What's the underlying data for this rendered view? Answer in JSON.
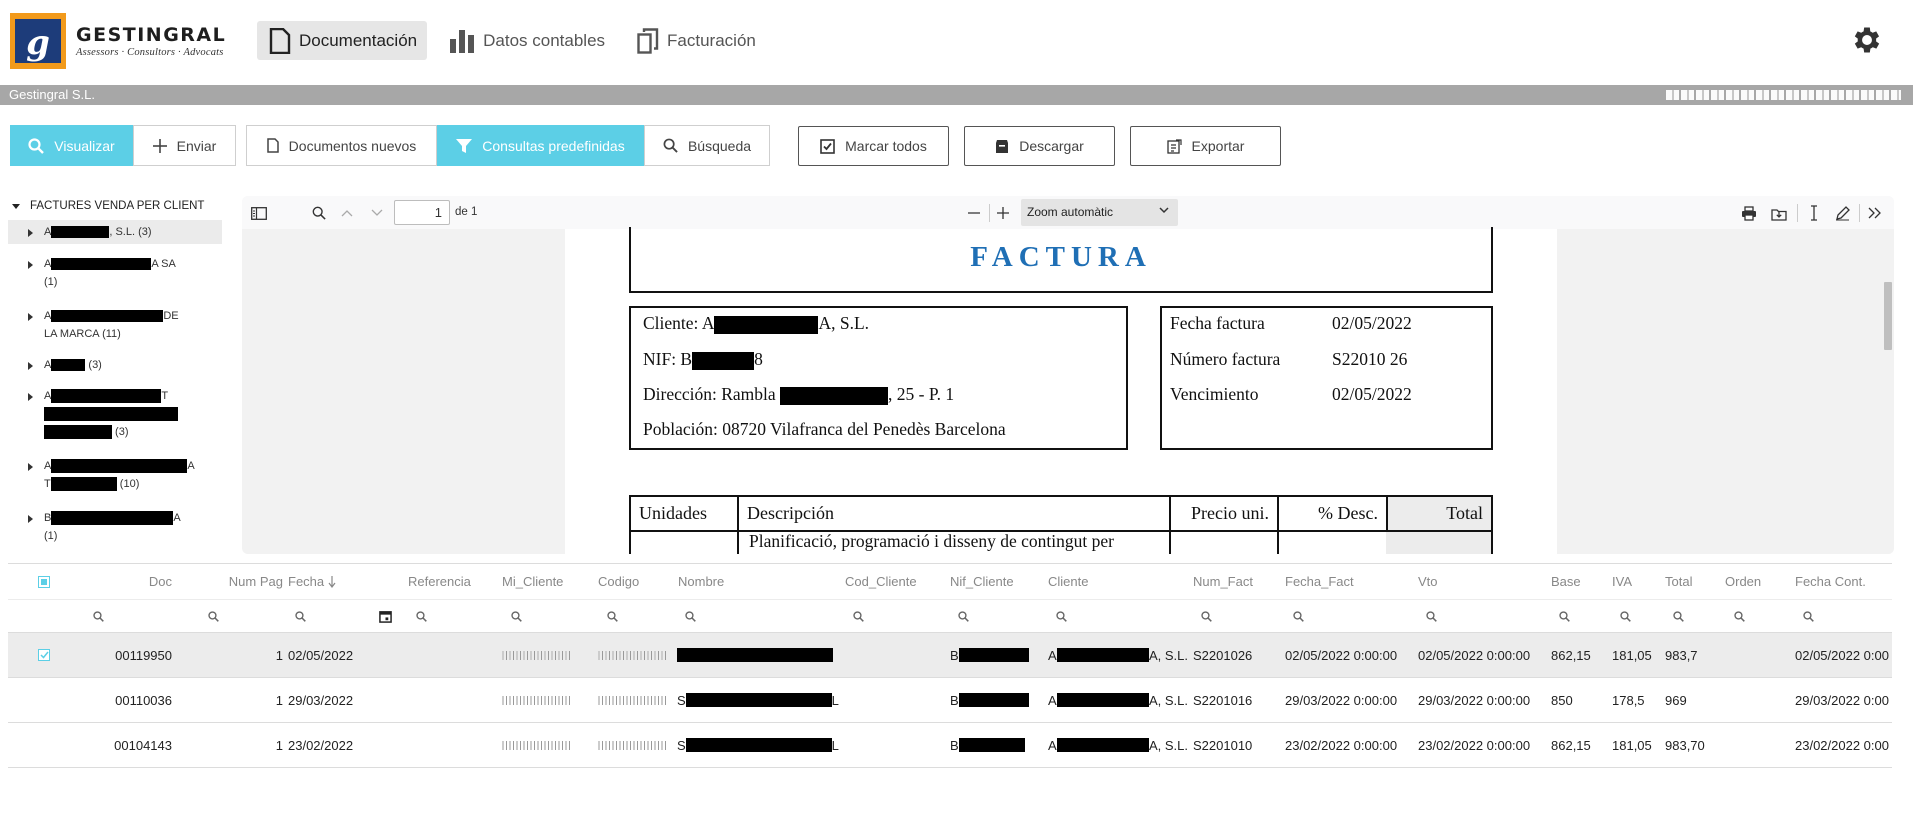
{
  "header": {
    "brand_name": "GESTINGRAL",
    "brand_tagline": "Assessors · Consultors · Advocats",
    "logo_letter": "g",
    "nav": [
      {
        "label": "Documentación",
        "active": true,
        "icon": "document-icon"
      },
      {
        "label": "Datos contables",
        "active": false,
        "icon": "bar-chart-icon"
      },
      {
        "label": "Facturación",
        "active": false,
        "icon": "copy-icon"
      }
    ],
    "settings_icon": "gear-icon"
  },
  "company_bar": {
    "name": "Gestingral S.L."
  },
  "toolbar": {
    "visualizar": "Visualizar",
    "enviar": "Enviar",
    "documentos_nuevos": "Documentos nuevos",
    "consultas_predefinidas": "Consultas predefinidas",
    "busqueda": "Búsqueda",
    "marcar_todos": "Marcar todos",
    "descargar": "Descargar",
    "exportar": "Exportar"
  },
  "tree": {
    "root": "FACTURES VENDA PER CLIENT",
    "items": [
      {
        "prefix": "A",
        "suffix": ", S.L. (3)",
        "selected": true
      },
      {
        "prefix": "A",
        "suffix": "A SA",
        "line2": "(1)"
      },
      {
        "prefix": "A",
        "suffix": "DE",
        "line2": "LA MARCA (11)"
      },
      {
        "prefix": "A",
        "suffix": " (3)"
      },
      {
        "prefix": "A",
        "suffix": "T",
        "line3": " (3)"
      },
      {
        "prefix": "A",
        "suffix": "A",
        "line2_prefix": "T",
        "line2": " (10)"
      },
      {
        "prefix": "B",
        "suffix": "A",
        "line2": "(1)"
      }
    ]
  },
  "viewer": {
    "page_value": "1",
    "page_total": "de 1",
    "zoom": "Zoom automàtic",
    "document": {
      "title": "FACTURA",
      "cliente_label": "Cliente: A",
      "cliente_suffix": "A, S.L.",
      "nif_label": "NIF: B",
      "nif_suffix": "8",
      "direccion_label": "Dirección: Rambla",
      "direccion_suffix": ", 25 - P. 1",
      "poblacion": "Población: 08720 Vilafranca del Penedès Barcelona",
      "fecha_factura_label": "Fecha factura",
      "fecha_factura": "02/05/2022",
      "numero_factura_label": "Número factura",
      "numero_factura": "S22010 26",
      "vencimiento_label": "Vencimiento",
      "vencimiento": "02/05/2022",
      "col_unidades": "Unidades",
      "col_descripcion": "Descripción",
      "col_precio": "Precio uni.",
      "col_desc": "% Desc.",
      "col_total": "Total",
      "first_line": "Planificació, programació i disseny de contingut per"
    }
  },
  "grid": {
    "columns": [
      "Doc",
      "Num Pag",
      "Fecha",
      "Referencia",
      "Mi_Cliente",
      "Codigo",
      "Nombre",
      "Cod_Cliente",
      "Nif_Cliente",
      "Cliente",
      "Num_Fact",
      "Fecha_Fact",
      "Vto",
      "Base",
      "IVA",
      "Total",
      "Orden",
      "Fecha Cont."
    ],
    "rows": [
      {
        "doc": "00119950",
        "num_pag": "1",
        "fecha": "02/05/2022",
        "nif_prefix": "B",
        "cliente_prefix": "A",
        "cliente_suffix": "A, S.L.",
        "num_fact": "S2201026",
        "fecha_fact": "02/05/2022 0:00:00",
        "vto": "02/05/2022 0:00:00",
        "base": "862,15",
        "iva": "181,05",
        "total": "983,7",
        "fecha_cont": "02/05/2022 0:00",
        "checked": true
      },
      {
        "doc": "00110036",
        "num_pag": "1",
        "fecha": "29/03/2022",
        "nombre_prefix": "S",
        "nombre_suffix": "L",
        "nif_prefix": "B",
        "cliente_prefix": "A",
        "cliente_suffix": "A, S.L.",
        "num_fact": "S2201016",
        "fecha_fact": "29/03/2022 0:00:00",
        "vto": "29/03/2022 0:00:00",
        "base": "850",
        "iva": "178,5",
        "total": "969",
        "fecha_cont": "29/03/2022 0:00",
        "checked": false
      },
      {
        "doc": "00104143",
        "num_pag": "1",
        "fecha": "23/02/2022",
        "nombre_prefix": "S",
        "nombre_suffix": "L",
        "nif_prefix": "B",
        "cliente_prefix": "A",
        "cliente_suffix": "A, S.L.",
        "num_fact": "S2201010",
        "fecha_fact": "23/02/2022 0:00:00",
        "vto": "23/02/2022 0:00:00",
        "base": "862,15",
        "iva": "181,05",
        "total": "983,70",
        "fecha_cont": "23/02/2022 0:00",
        "checked": false
      }
    ]
  },
  "colors": {
    "accent": "#5ccfe6",
    "company_bar": "#a7a7a7",
    "logo_orange": "#f29a1b",
    "logo_navy": "#1d3c7a",
    "invoice_blue": "#1f6fb5"
  }
}
